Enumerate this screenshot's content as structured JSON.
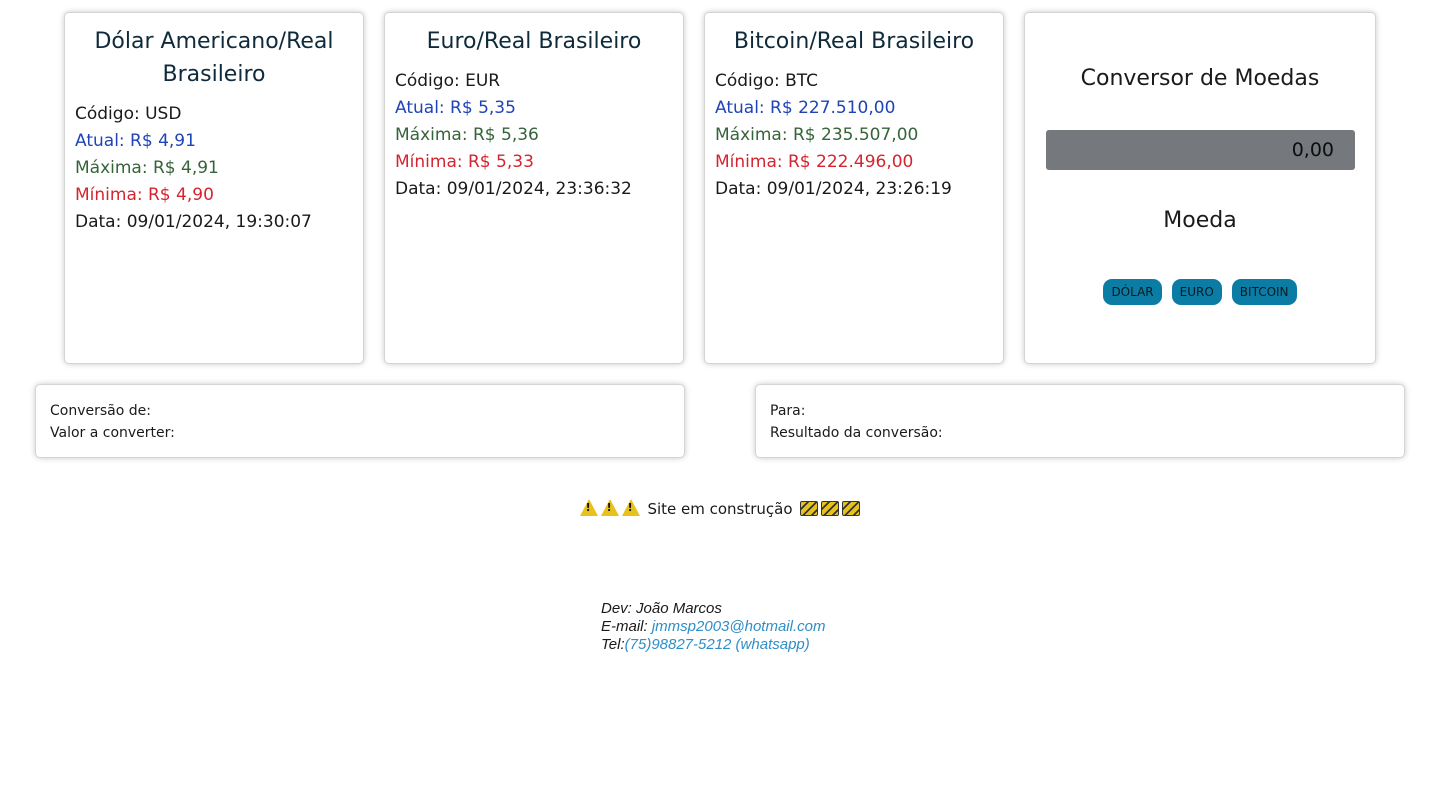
{
  "cards": [
    {
      "title": "Dólar Americano/Real Brasileiro",
      "code": "Código: USD",
      "atual": "Atual: R$ 4,91",
      "maxima": "Máxima: R$ 4,91",
      "minima": "Mínima: R$ 4,90",
      "data": "Data: 09/01/2024, 19:30:07"
    },
    {
      "title": "Euro/Real Brasileiro",
      "code": "Código: EUR",
      "atual": "Atual: R$ 5,35",
      "maxima": "Máxima: R$ 5,36",
      "minima": "Mínima: R$ 5,33",
      "data": "Data: 09/01/2024, 23:36:32"
    },
    {
      "title": "Bitcoin/Real Brasileiro",
      "code": "Código: BTC",
      "atual": "Atual: R$ 227.510,00",
      "maxima": "Máxima: R$ 235.507,00",
      "minima": "Mínima: R$ 222.496,00",
      "data": "Data: 09/01/2024, 23:26:19"
    }
  ],
  "converter": {
    "title": "Conversor de Moedas",
    "input_value": "0,00",
    "currency_label": "Moeda",
    "buttons": [
      "DÓLAR",
      "EURO",
      "BITCOIN"
    ]
  },
  "conversion_from": {
    "from_label": "Conversão de:",
    "amount_label": "Valor a converter:"
  },
  "conversion_to": {
    "to_label": "Para:",
    "result_label": "Resultado da conversão:"
  },
  "notice": {
    "text": "Site em construção",
    "left_icons": [
      "warning-icon",
      "warning-icon",
      "warning-icon"
    ],
    "right_icons": [
      "construction-icon",
      "construction-icon",
      "construction-icon"
    ]
  },
  "footer": {
    "dev": "Dev: João Marcos",
    "email_label": "E-mail: ",
    "email": "jmmsp2003@hotmail.com",
    "tel_label": "Tel:",
    "tel": "(75)98827-5212 (whatsapp)"
  },
  "colors": {
    "atual": "#1f44b8",
    "maxima": "#36643a",
    "minima": "#d4252f",
    "button_bg": "#0b7da4",
    "input_bg": "#75787d",
    "link": "#2f8ec6"
  }
}
